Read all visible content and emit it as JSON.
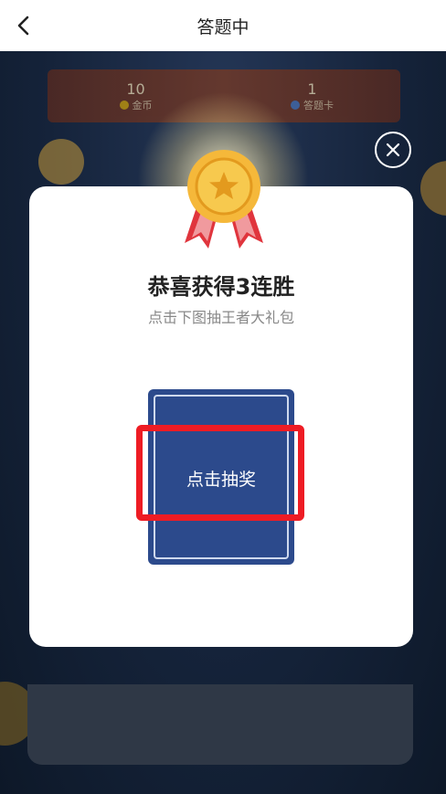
{
  "header": {
    "title": "答题中",
    "back_icon": "chevron-left-icon"
  },
  "stats": [
    {
      "value": "10",
      "label": "金币",
      "color": "#e6b800"
    },
    {
      "value": "1",
      "label": "答题卡",
      "color": "#3f7fd6"
    }
  ],
  "modal": {
    "title": "恭喜获得3连胜",
    "subtitle": "点击下图抽王者大礼包",
    "card_label": "点击抽奖",
    "close_icon": "close-icon",
    "medal_icon": "medal-icon"
  },
  "colors": {
    "card": "#2c4a8c",
    "highlight": "#ee1c24",
    "medal": "#f5b83a",
    "ribbon": "#e0353d"
  }
}
